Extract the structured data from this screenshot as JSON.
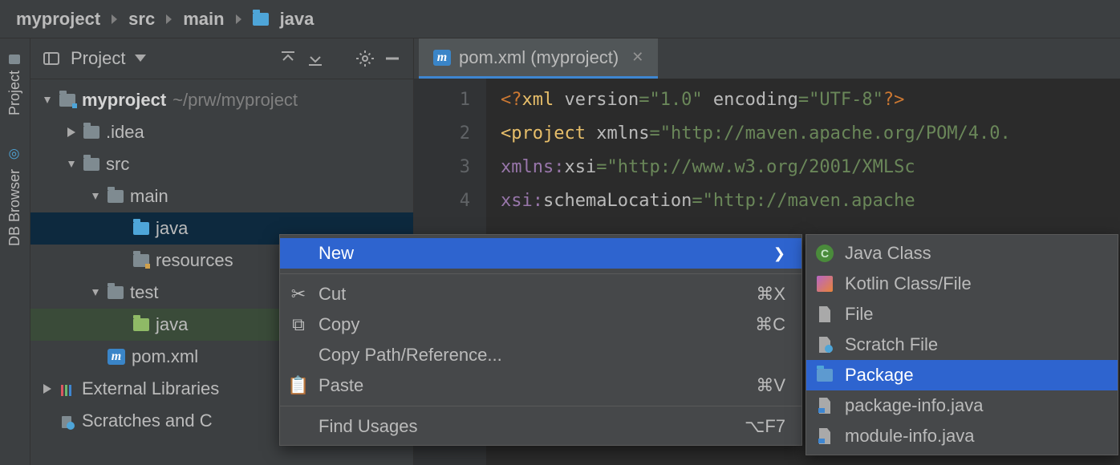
{
  "breadcrumb": {
    "items": [
      "myproject",
      "src",
      "main",
      "java"
    ]
  },
  "toolStrip": {
    "project_label": "Project",
    "dbbrowser_label": "DB Browser"
  },
  "projectPanel": {
    "header_label": "Project",
    "root": "myproject",
    "root_path": "~/prw/myproject",
    "idea_dir": ".idea",
    "src_dir": "src",
    "main_dir": "main",
    "java_dir": "java",
    "resources_dir": "resources",
    "test_dir": "test",
    "test_java_dir": "java",
    "pomxml": "pom.xml",
    "ext_lib": "External Libraries",
    "scratches": "Scratches and C"
  },
  "tab": {
    "label": "pom.xml (myproject)"
  },
  "gutter": {
    "l1": "1",
    "l2": "2",
    "l3": "3",
    "l4": "4"
  },
  "contextMenu": {
    "new_label": "New",
    "cut_label": "Cut",
    "cut_sc": "⌘X",
    "copy_label": "Copy",
    "copy_sc": "⌘C",
    "copy_path_label": "Copy Path/Reference...",
    "paste_label": "Paste",
    "paste_sc": "⌘V",
    "find_usages_label": "Find Usages",
    "find_usages_sc": "⌥F7"
  },
  "subMenu": {
    "java_class": "Java Class",
    "kotlin": "Kotlin Class/File",
    "file": "File",
    "scratch": "Scratch File",
    "package": "Package",
    "pkg_info": "package-info.java",
    "mod_info": "module-info.java"
  }
}
